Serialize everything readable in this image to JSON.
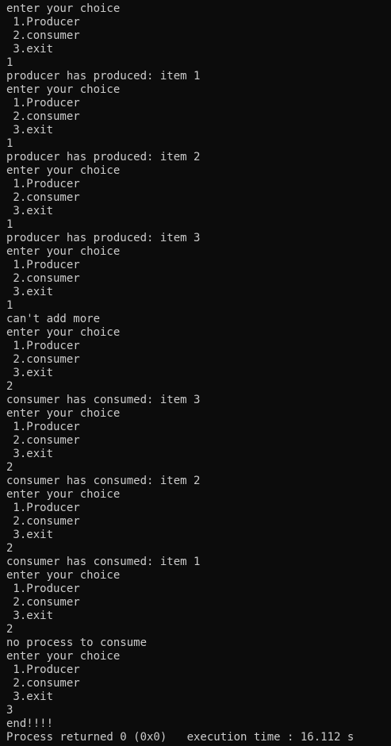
{
  "console": {
    "lines": [
      "enter your choice",
      " 1.Producer",
      " 2.consumer",
      " 3.exit",
      "1",
      "producer has produced: item 1",
      "enter your choice",
      " 1.Producer",
      " 2.consumer",
      " 3.exit",
      "1",
      "producer has produced: item 2",
      "enter your choice",
      " 1.Producer",
      " 2.consumer",
      " 3.exit",
      "1",
      "producer has produced: item 3",
      "enter your choice",
      " 1.Producer",
      " 2.consumer",
      " 3.exit",
      "1",
      "can't add more",
      "enter your choice",
      " 1.Producer",
      " 2.consumer",
      " 3.exit",
      "2",
      "consumer has consumed: item 3",
      "enter your choice",
      " 1.Producer",
      " 2.consumer",
      " 3.exit",
      "2",
      "consumer has consumed: item 2",
      "enter your choice",
      " 1.Producer",
      " 2.consumer",
      " 3.exit",
      "2",
      "consumer has consumed: item 1",
      "enter your choice",
      " 1.Producer",
      " 2.consumer",
      " 3.exit",
      "2",
      "no process to consume",
      "enter your choice",
      " 1.Producer",
      " 2.consumer",
      " 3.exit",
      "3",
      "end!!!!",
      "Process returned 0 (0x0)   execution time : 16.112 s"
    ],
    "background_color": "#0c0c0c",
    "text_color": "#cccccc"
  }
}
